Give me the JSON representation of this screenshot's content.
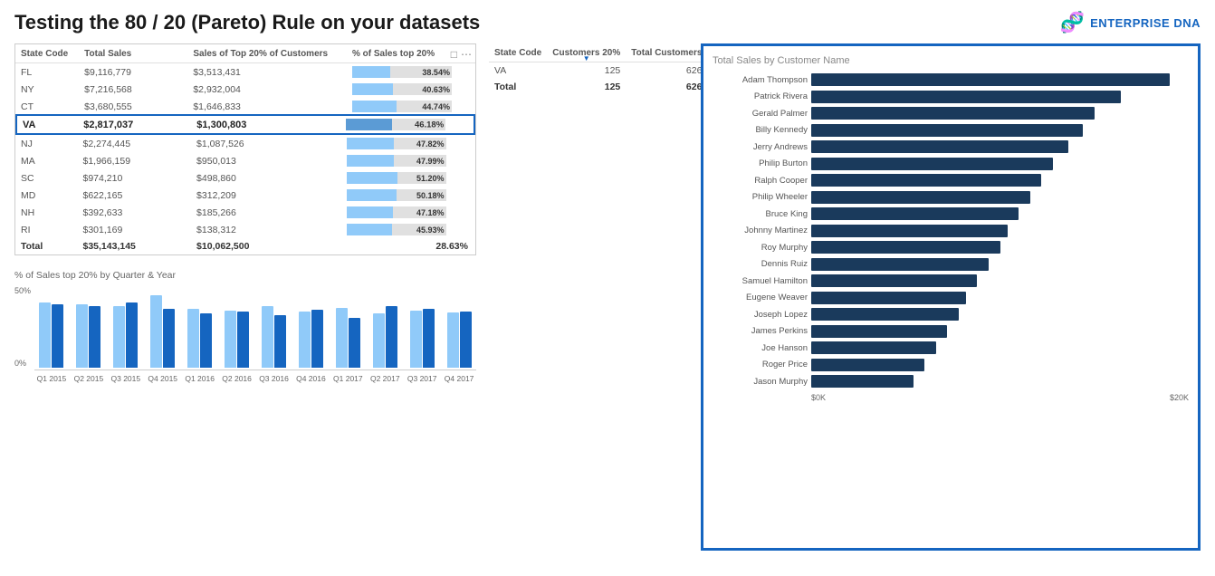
{
  "header": {
    "title": "Testing the 80 / 20 (Pareto) Rule on your datasets",
    "logo_icon": "🧬",
    "logo_text": "ENTERPRISE DNA"
  },
  "left_table": {
    "columns": [
      "State Code",
      "Total Sales",
      "Sales of Top 20% of Customers",
      "% of Sales top 20%"
    ],
    "rows": [
      {
        "state": "FL",
        "total_sales": "$9,116,779",
        "top20_sales": "$3,513,431",
        "pct": 38.54,
        "pct_label": "38.54%"
      },
      {
        "state": "NY",
        "total_sales": "$7,216,568",
        "top20_sales": "$2,932,004",
        "pct": 40.63,
        "pct_label": "40.63%"
      },
      {
        "state": "CT",
        "total_sales": "$3,680,555",
        "top20_sales": "$1,646,833",
        "pct": 44.74,
        "pct_label": "44.74%"
      }
    ],
    "highlighted_row": {
      "state": "VA",
      "total_sales": "$2,817,037",
      "top20_sales": "$1,300,803",
      "pct": 46.18,
      "pct_label": "46.18%"
    },
    "lower_rows": [
      {
        "state": "NJ",
        "total_sales": "$2,274,445",
        "top20_sales": "$1,087,526",
        "pct": 47.82,
        "pct_label": "47.82%"
      },
      {
        "state": "MA",
        "total_sales": "$1,966,159",
        "top20_sales": "$950,013",
        "pct": 47.99,
        "pct_label": "47.99%"
      },
      {
        "state": "SC",
        "total_sales": "$974,210",
        "top20_sales": "$498,860",
        "pct": 51.2,
        "pct_label": "51.20%"
      },
      {
        "state": "MD",
        "total_sales": "$622,165",
        "top20_sales": "$312,209",
        "pct": 50.18,
        "pct_label": "50.18%"
      },
      {
        "state": "NH",
        "total_sales": "$392,633",
        "top20_sales": "$185,266",
        "pct": 47.18,
        "pct_label": "47.18%"
      },
      {
        "state": "RI",
        "total_sales": "$301,169",
        "top20_sales": "$138,312",
        "pct": 45.93,
        "pct_label": "45.93%"
      }
    ],
    "total_row": {
      "state": "Total",
      "total_sales": "$35,143,145",
      "top20_sales": "$10,062,500",
      "pct_label": "28.63%"
    }
  },
  "middle_table": {
    "columns": [
      "State Code",
      "Customers 20%",
      "Total Customers"
    ],
    "rows": [
      {
        "state": "VA",
        "customers20": "125",
        "total": "626"
      },
      {
        "state": "Total",
        "customers20": "125",
        "total": "626",
        "is_total": true
      }
    ]
  },
  "right_chart": {
    "title": "Total Sales by Customer Name",
    "x_labels": [
      "$0K",
      "$20K"
    ],
    "bars": [
      {
        "name": "Adam Thompson",
        "value": 95
      },
      {
        "name": "Patrick Rivera",
        "value": 82
      },
      {
        "name": "Gerald Palmer",
        "value": 75
      },
      {
        "name": "Billy Kennedy",
        "value": 72
      },
      {
        "name": "Jerry Andrews",
        "value": 68
      },
      {
        "name": "Philip Burton",
        "value": 64
      },
      {
        "name": "Ralph Cooper",
        "value": 61
      },
      {
        "name": "Philip Wheeler",
        "value": 58
      },
      {
        "name": "Bruce King",
        "value": 55
      },
      {
        "name": "Johnny Martinez",
        "value": 52
      },
      {
        "name": "Roy Murphy",
        "value": 50
      },
      {
        "name": "Dennis Ruiz",
        "value": 47
      },
      {
        "name": "Samuel Hamilton",
        "value": 44
      },
      {
        "name": "Eugene Weaver",
        "value": 41
      },
      {
        "name": "Joseph Lopez",
        "value": 39
      },
      {
        "name": "James Perkins",
        "value": 36
      },
      {
        "name": "Joe Hanson",
        "value": 33
      },
      {
        "name": "Roger Price",
        "value": 30
      },
      {
        "name": "Jason Murphy",
        "value": 27
      }
    ]
  },
  "bottom_chart": {
    "title": "% of Sales top 20% by Quarter & Year",
    "y_labels": [
      "50%",
      "0%"
    ],
    "groups": [
      {
        "label": "Q1 2015",
        "dark": 70,
        "light": 72
      },
      {
        "label": "Q2 2015",
        "dark": 68,
        "light": 70
      },
      {
        "label": "Q3 2015",
        "dark": 72,
        "light": 68
      },
      {
        "label": "Q4 2015",
        "dark": 65,
        "light": 80
      },
      {
        "label": "Q1 2016",
        "dark": 60,
        "light": 65
      },
      {
        "label": "Q2 2016",
        "dark": 62,
        "light": 63
      },
      {
        "label": "Q3 2016",
        "dark": 58,
        "light": 68
      },
      {
        "label": "Q4 2016",
        "dark": 64,
        "light": 62
      },
      {
        "label": "Q1 2017",
        "dark": 55,
        "light": 66
      },
      {
        "label": "Q2 2017",
        "dark": 68,
        "light": 60
      },
      {
        "label": "Q3 2017",
        "dark": 65,
        "light": 63
      },
      {
        "label": "Q4 2017",
        "dark": 62,
        "light": 61
      }
    ]
  }
}
